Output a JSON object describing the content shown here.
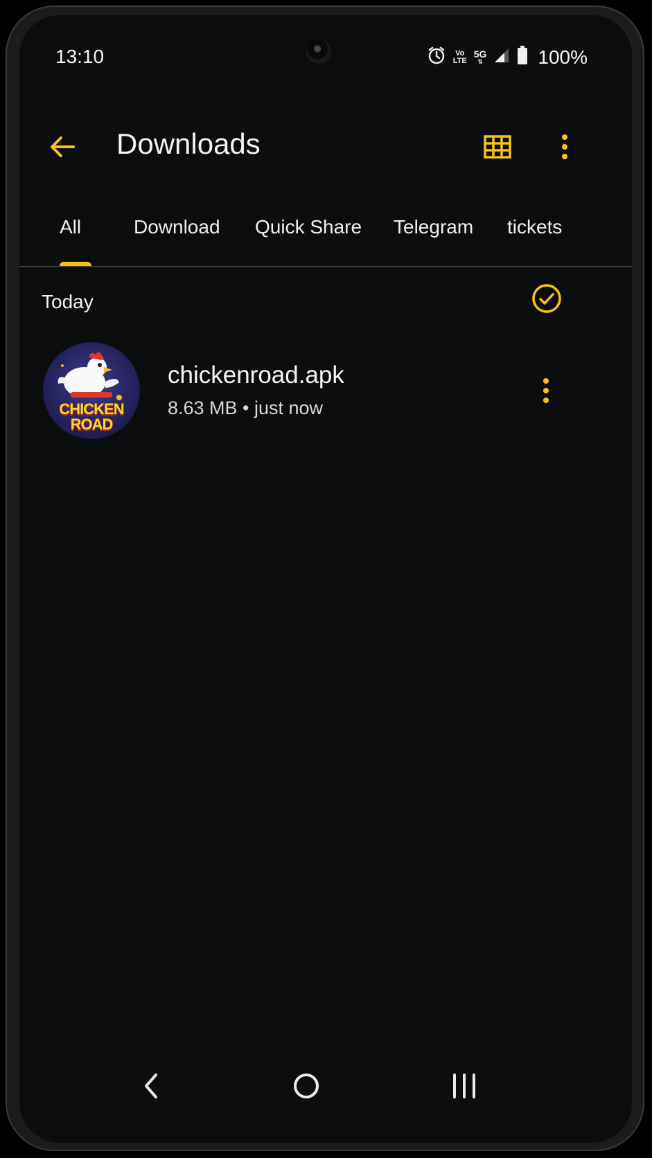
{
  "status_bar": {
    "time": "13:10",
    "volte_top": "Vo",
    "volte_bottom": "LTE",
    "network": "5G",
    "battery": "100%",
    "icons": [
      "alarm-icon",
      "volte-icon",
      "5g-icon",
      "signal-icon",
      "battery-icon"
    ]
  },
  "app_bar": {
    "title": "Downloads",
    "icons": [
      "back-arrow-icon",
      "grid-view-icon",
      "more-vert-icon"
    ]
  },
  "tabs": [
    {
      "label": "All",
      "selected": true
    },
    {
      "label": "Download",
      "selected": false
    },
    {
      "label": "Quick Share",
      "selected": false
    },
    {
      "label": "Telegram",
      "selected": false
    },
    {
      "label": "tickets",
      "selected": false
    }
  ],
  "section": {
    "title": "Today",
    "icon": "check-circle-icon"
  },
  "files": [
    {
      "name": "chickenroad.apk",
      "meta": "8.63 MB • just now",
      "thumbnail_text_1": "CHICKEN",
      "thumbnail_text_2": "ROAD"
    }
  ],
  "nav_bar": {
    "icons": [
      "nav-back-icon",
      "nav-home-icon",
      "nav-recents-icon"
    ]
  },
  "colors": {
    "accent": "#f7c21a",
    "background": "#0c0d0f",
    "text": "#f2f2f2",
    "divider": "#3a3b3d"
  }
}
